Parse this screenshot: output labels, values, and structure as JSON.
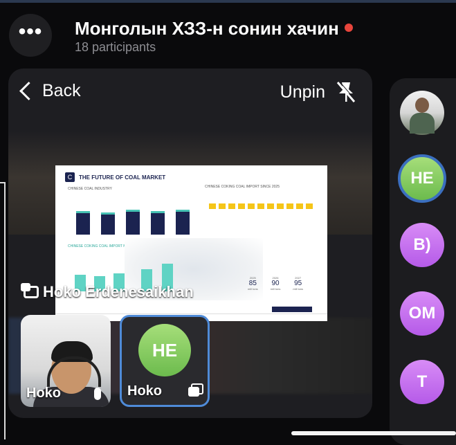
{
  "header": {
    "menu_glyph": "•••",
    "title": "Монголын ХЗЗ-н сонин хачин",
    "participants": "18 participants",
    "rec_color": "#e8453c"
  },
  "stage": {
    "back_label": "Back",
    "unpin_label": "Unpin",
    "speaker_name": "Hoko Erdenesaikhan",
    "slide": {
      "title": "THE FUTURE OF COAL MARKET",
      "section1": "CHINESE COAL INDUSTRY",
      "section2": "CHINESE COKING COAL IMPORT MARKET",
      "section3": "CHINESE COKING COAL IMPORT SINCE 2025",
      "projections": [
        {
          "year": "2025",
          "value": "85",
          "unit": "mill tons"
        },
        {
          "year": "2026",
          "value": "90",
          "unit": "mill tons"
        },
        {
          "year": "2027",
          "value": "95",
          "unit": "mill tons"
        }
      ]
    }
  },
  "tiles": [
    {
      "name": "Hoko",
      "icon": "mic-icon"
    },
    {
      "name": "Hoko",
      "initials": "HE",
      "icon": "screen-share-icon"
    }
  ],
  "rail": {
    "avatars": [
      "photo",
      "HE",
      "B)",
      "OM",
      "T"
    ]
  }
}
